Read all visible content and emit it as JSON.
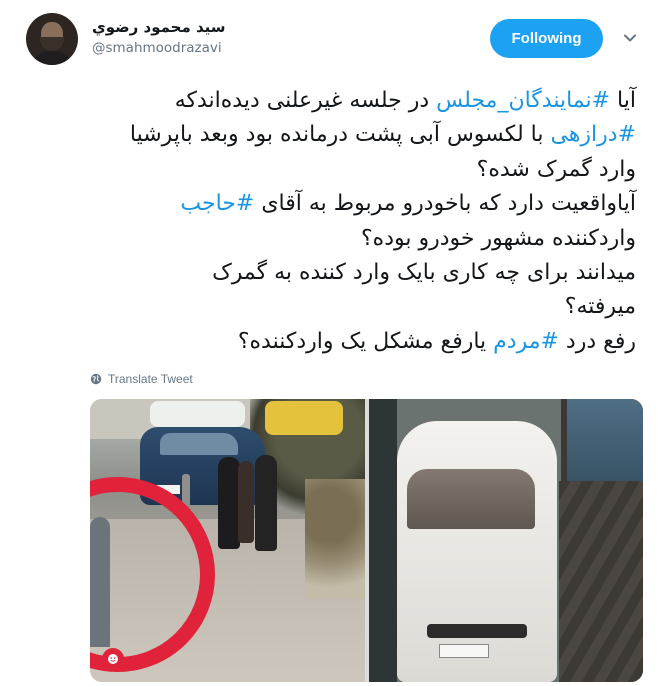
{
  "user": {
    "display_name": "سيد محمود رضوي",
    "handle": "@smahmoodrazavi"
  },
  "follow_button": {
    "label": "Following"
  },
  "tweet": {
    "lines": [
      [
        {
          "t": "آیا "
        },
        {
          "t": "#نمایندگان_مجلس",
          "tag": true
        },
        {
          "t": " در جلسه غیرعلنی دیده‌اندکه"
        }
      ],
      [
        {
          "t": "#درازهی",
          "tag": true
        },
        {
          "t": " با لکسوس آبی پشت درمانده بود وبعد باپرشیا"
        }
      ],
      [
        {
          "t": "وارد گمرک شده؟"
        }
      ],
      [
        {
          "t": "آیاواقعیت دارد که باخودرو مربوط به آقای "
        },
        {
          "t": "#حاجب",
          "tag": true
        }
      ],
      [
        {
          "t": "واردکننده مشهور خودرو بوده؟"
        }
      ],
      [
        {
          "t": "میدانند برای چه کاری بایک وارد کننده به گمرک"
        }
      ],
      [
        {
          "t": "میرفته؟"
        }
      ],
      [
        {
          "t": "رفع درد "
        },
        {
          "t": "#مردم",
          "tag": true
        },
        {
          "t": " یارفع مشکل یک واردکننده؟"
        }
      ]
    ]
  },
  "translate": {
    "label": "Translate Tweet",
    "icon": "globe-icon"
  },
  "colors": {
    "accent": "#1da1f2",
    "hashtag": "#1b95e0",
    "muted": "#657786"
  }
}
